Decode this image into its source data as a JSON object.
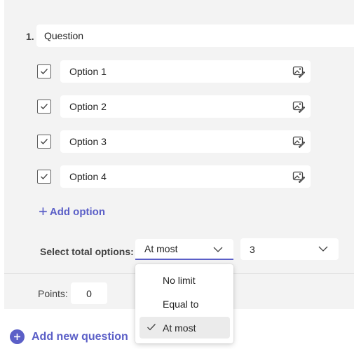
{
  "question": {
    "number": "1.",
    "title": "Question"
  },
  "options": [
    {
      "label": "Option 1",
      "checked": true
    },
    {
      "label": "Option 2",
      "checked": true
    },
    {
      "label": "Option 3",
      "checked": true
    },
    {
      "label": "Option 4",
      "checked": true
    }
  ],
  "add_option_label": "Add option",
  "total_options": {
    "label": "Select total options:",
    "mode_value": "At most",
    "count_value": "3",
    "dropdown_items": [
      "No limit",
      "Equal to",
      "At most"
    ],
    "selected_item": "At most"
  },
  "points": {
    "label": "Points:",
    "value": "0"
  },
  "add_question_label": "Add new question",
  "colors": {
    "accent": "#5b5fc7",
    "panel": "#f3f3f3",
    "selected": "#ebebeb"
  },
  "icons": {
    "checkbox": "checkmark-icon",
    "option_image": "image-edit-icon",
    "add_option": "plus-icon",
    "dropdown": "chevron-down-icon",
    "selected_item": "checkmark-icon",
    "add_question": "add-circle-icon"
  }
}
